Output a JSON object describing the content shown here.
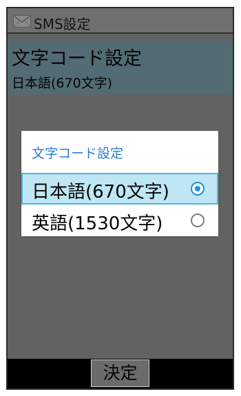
{
  "header": {
    "title": "SMS設定",
    "icon": "envelope-icon"
  },
  "setting": {
    "title": "文字コード設定",
    "value": "日本語(670文字)"
  },
  "dialog": {
    "title": "文字コード設定",
    "options": [
      {
        "label": "日本語(670文字)",
        "selected": true
      },
      {
        "label": "英語(1530文字)",
        "selected": false
      }
    ]
  },
  "softkey": {
    "center_label": "決定"
  },
  "colors": {
    "accent": "#2a7bd0",
    "radio_selected": "#1e90d6",
    "selected_row_bg": "#bfe6f4",
    "setting_row_bg": "#536b73"
  }
}
